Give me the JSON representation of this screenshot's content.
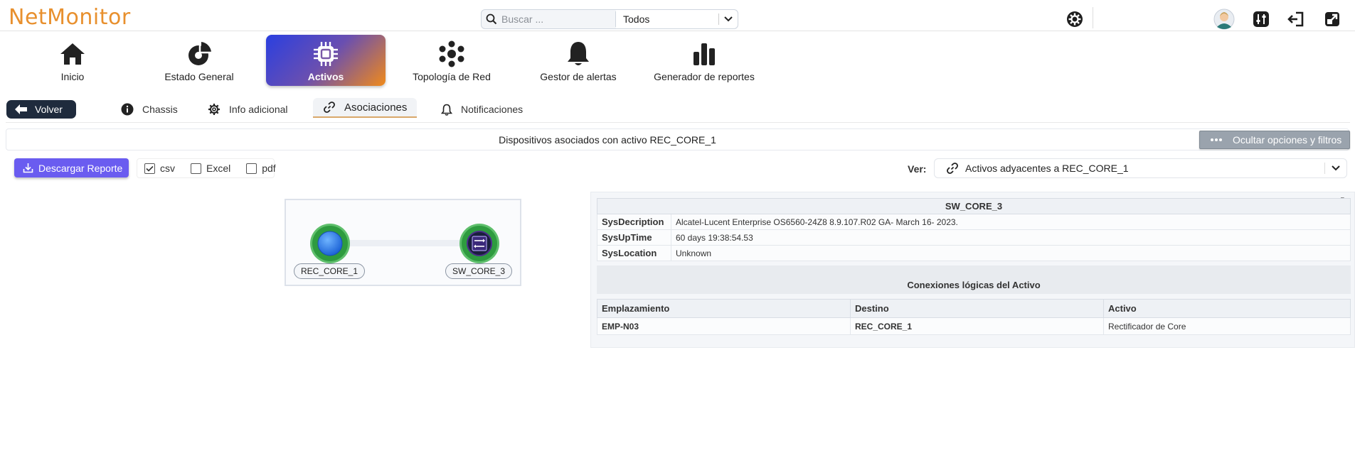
{
  "app": {
    "logo": "NetMonitor"
  },
  "search": {
    "placeholder": "Buscar ...",
    "scope_selected": "Todos"
  },
  "header_icons": [
    "settings-icon",
    "user-avatar",
    "sliders-icon",
    "logout-icon",
    "open-external-icon"
  ],
  "main_nav": [
    {
      "label": "Inicio",
      "icon": "home-icon"
    },
    {
      "label": "Estado General",
      "icon": "pie-chart-icon"
    },
    {
      "label": "Activos",
      "icon": "chip-icon",
      "active": true
    },
    {
      "label": "Topología de Red",
      "icon": "network-icon"
    },
    {
      "label": "Gestor de alertas",
      "icon": "bell-icon"
    },
    {
      "label": "Generador de reportes",
      "icon": "bar-chart-icon"
    }
  ],
  "subnav": {
    "back_label": "Volver",
    "tabs": [
      {
        "label": "Chassis",
        "icon": "info-icon"
      },
      {
        "label": "Info adicional",
        "icon": "gear-icon"
      },
      {
        "label": "Asociaciones",
        "icon": "link-icon",
        "active": true
      },
      {
        "label": "Notificaciones",
        "icon": "bell-icon"
      }
    ]
  },
  "title_bar": {
    "text": "Dispositivos asociados con activo REC_CORE_1",
    "toggle_label": "Ocultar opciones y filtros"
  },
  "report": {
    "download_label": "Descargar Reporte",
    "formats": [
      {
        "label": "csv",
        "checked": true
      },
      {
        "label": "Excel",
        "checked": false
      },
      {
        "label": "pdf",
        "checked": false
      }
    ]
  },
  "view": {
    "label": "Ver:",
    "selected": "Activos adyacentes a REC_CORE_1"
  },
  "graph": {
    "nodes": [
      {
        "label": "REC_CORE_1",
        "type": "rectifier"
      },
      {
        "label": "SW_CORE_3",
        "type": "switch"
      }
    ]
  },
  "detail": {
    "title": "SW_CORE_3",
    "properties": [
      {
        "key": "SysDecription",
        "value": "Alcatel-Lucent Enterprise OS6560-24Z8 8.9.107.R02 GA- March 16- 2023."
      },
      {
        "key": "SysUpTime",
        "value": "60 days 19:38:54.53"
      },
      {
        "key": "SysLocation",
        "value": "Unknown"
      }
    ],
    "connections_title": "Conexiones lógicas del Activo",
    "columns": [
      "Emplazamiento",
      "Destino",
      "Activo"
    ],
    "rows": [
      [
        "EMP-N03",
        "REC_CORE_1",
        "Rectificador de Core"
      ]
    ]
  },
  "colors": {
    "logo": "#e8902e",
    "active_gradient_start": "#2a3fe0",
    "active_gradient_end": "#f08a1a",
    "report_button": "#6a5cf0",
    "back_button": "#1f2b3d",
    "node_ring": "#2e9b3f"
  }
}
